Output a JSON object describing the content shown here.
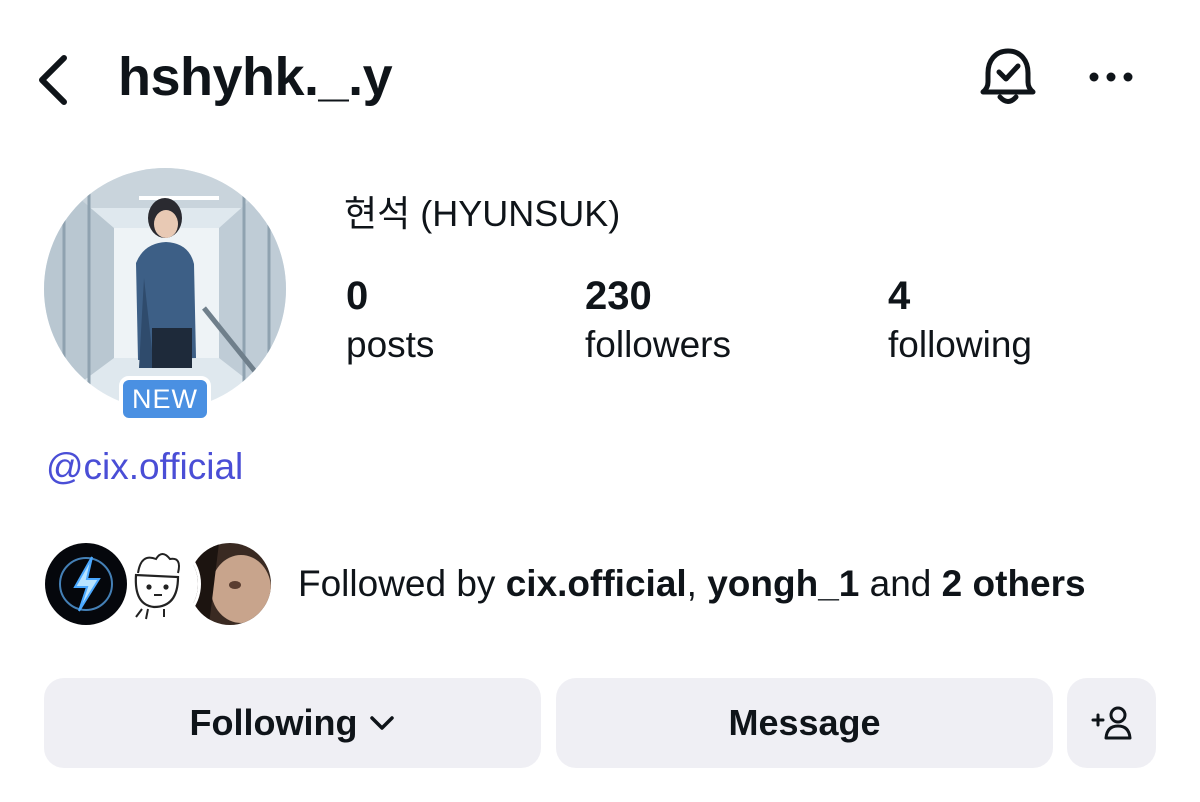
{
  "header": {
    "username": "hshyhk._.y",
    "back_icon": "chevron-left-icon",
    "notify_icon": "bell-check-icon",
    "more_icon": "more-horizontal-icon"
  },
  "profile": {
    "display_name": "현석 (HYUNSUK)",
    "badge": "NEW",
    "mention": "@cix.official",
    "stats": [
      {
        "value": "0",
        "label": "posts"
      },
      {
        "value": "230",
        "label": "followers"
      },
      {
        "value": "4",
        "label": "following"
      }
    ]
  },
  "followed_by": {
    "prefix": "Followed by ",
    "user1": "cix.official",
    "sep": ", ",
    "user2": "yongh_1",
    "mid": " and ",
    "others": "2 others"
  },
  "actions": {
    "following_label": "Following",
    "message_label": "Message",
    "add_icon": "add-person-icon"
  },
  "colors": {
    "accent": "#4a90e2",
    "mention": "#4a4ed6",
    "button_bg": "#efeff4"
  }
}
